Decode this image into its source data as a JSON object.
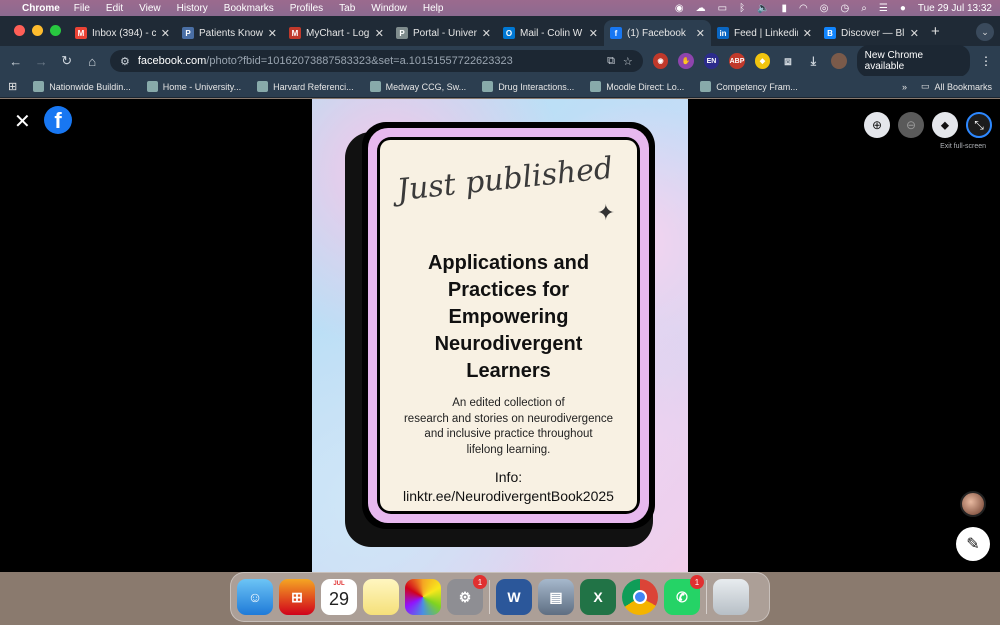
{
  "menubar": {
    "app_name": "Chrome",
    "menus": [
      "File",
      "Edit",
      "View",
      "History",
      "Bookmarks",
      "Profiles",
      "Tab",
      "Window",
      "Help"
    ],
    "datetime": "Tue 29 Jul  13:32"
  },
  "tabs": [
    {
      "title": "Inbox (394) - c",
      "icon": "gmail-icon",
      "color": "#ea4335",
      "glyph": "M",
      "active": false
    },
    {
      "title": "Patients Know",
      "icon": "patients-know-icon",
      "color": "#4a6fa5",
      "glyph": "P",
      "active": false
    },
    {
      "title": "MyChart - Log",
      "icon": "mychart-icon",
      "color": "#c0392b",
      "glyph": "M",
      "active": false
    },
    {
      "title": "Portal - Univer",
      "icon": "portal-icon",
      "color": "#7f8c8d",
      "glyph": "P",
      "active": false
    },
    {
      "title": "Mail - Colin W",
      "icon": "outlook-icon",
      "color": "#0078d4",
      "glyph": "O",
      "active": false
    },
    {
      "title": "(1) Facebook",
      "icon": "facebook-icon",
      "color": "#1877f2",
      "glyph": "f",
      "active": true
    },
    {
      "title": "Feed | Linkedin",
      "icon": "linkedin-icon",
      "color": "#0a66c2",
      "glyph": "in",
      "active": false
    },
    {
      "title": "Discover — Blu",
      "icon": "bluesky-icon",
      "color": "#1185fe",
      "glyph": "B",
      "active": false
    }
  ],
  "toolbar": {
    "url_host": "facebook.com",
    "url_path": "/photo?fbid=10162073887583323&set=a.10151557722623323",
    "new_chrome_label": "New Chrome available",
    "ext_en": "EN",
    "ext_abp": "ABP"
  },
  "bookmarks": {
    "items": [
      "Nationwide Buildin...",
      "Home - University...",
      "Harvard Referenci...",
      "Medway CCG, Sw...",
      "Drug Interactions...",
      "Moodle Direct: Lo...",
      "Competency Fram..."
    ],
    "all_label": "All Bookmarks",
    "overflow": "»"
  },
  "viewer": {
    "exit_tooltip": "Exit full-screen",
    "fb_letter": "f"
  },
  "photo": {
    "tagline": "Just published",
    "title_lines": [
      "Applications and",
      "Practices for",
      "Empowering",
      "Neurodivergent",
      "Learners"
    ],
    "desc_lines": [
      "An edited collection of",
      "research and stories on neurodivergence",
      "and inclusive practice throughout",
      "lifelong learning."
    ],
    "info_label": "Info:",
    "info_link": "linktr.ee/NeurodivergentBook2025"
  },
  "dock": {
    "calendar_month": "JUL",
    "calendar_day": "29",
    "settings_badge": "1",
    "whatsapp_badge": "1"
  }
}
